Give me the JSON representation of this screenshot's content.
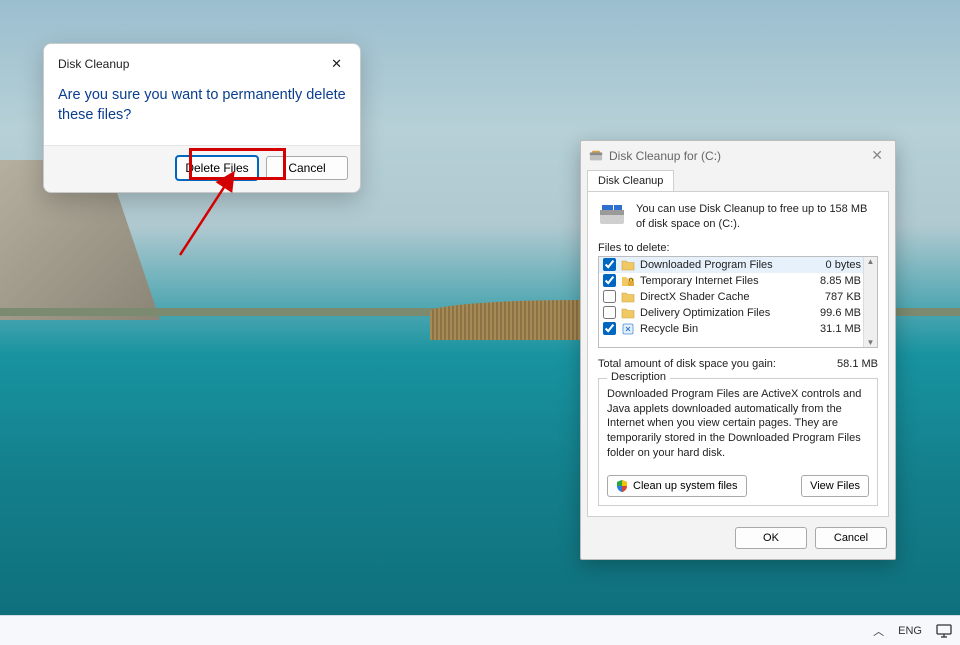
{
  "confirm": {
    "title": "Disk Cleanup",
    "message": "Are you sure you want to permanently delete these files?",
    "delete_label": "Delete Files",
    "cancel_label": "Cancel"
  },
  "props": {
    "title": "Disk Cleanup for  (C:)",
    "tab_label": "Disk Cleanup",
    "intro": "You can use Disk Cleanup to free up to 158 MB of disk space on  (C:).",
    "files_label": "Files to delete:",
    "items": [
      {
        "checked": true,
        "icon": "folder",
        "name": "Downloaded Program Files",
        "size": "0 bytes",
        "selected": true
      },
      {
        "checked": true,
        "icon": "lock",
        "name": "Temporary Internet Files",
        "size": "8.85 MB",
        "selected": false
      },
      {
        "checked": false,
        "icon": "folder",
        "name": "DirectX Shader Cache",
        "size": "787 KB",
        "selected": false
      },
      {
        "checked": false,
        "icon": "folder",
        "name": "Delivery Optimization Files",
        "size": "99.6 MB",
        "selected": false
      },
      {
        "checked": true,
        "icon": "recycle",
        "name": "Recycle Bin",
        "size": "31.1 MB",
        "selected": false
      }
    ],
    "total_label": "Total amount of disk space you gain:",
    "total_value": "58.1 MB",
    "desc_legend": "Description",
    "desc_text": "Downloaded Program Files are ActiveX controls and Java applets downloaded automatically from the Internet when you view certain pages. They are temporarily stored in the Downloaded Program Files folder on your hard disk.",
    "cleanup_sys_label": "Clean up system files",
    "view_files_label": "View Files",
    "ok_label": "OK",
    "cancel_label": "Cancel"
  },
  "taskbar": {
    "lang": "ENG"
  }
}
